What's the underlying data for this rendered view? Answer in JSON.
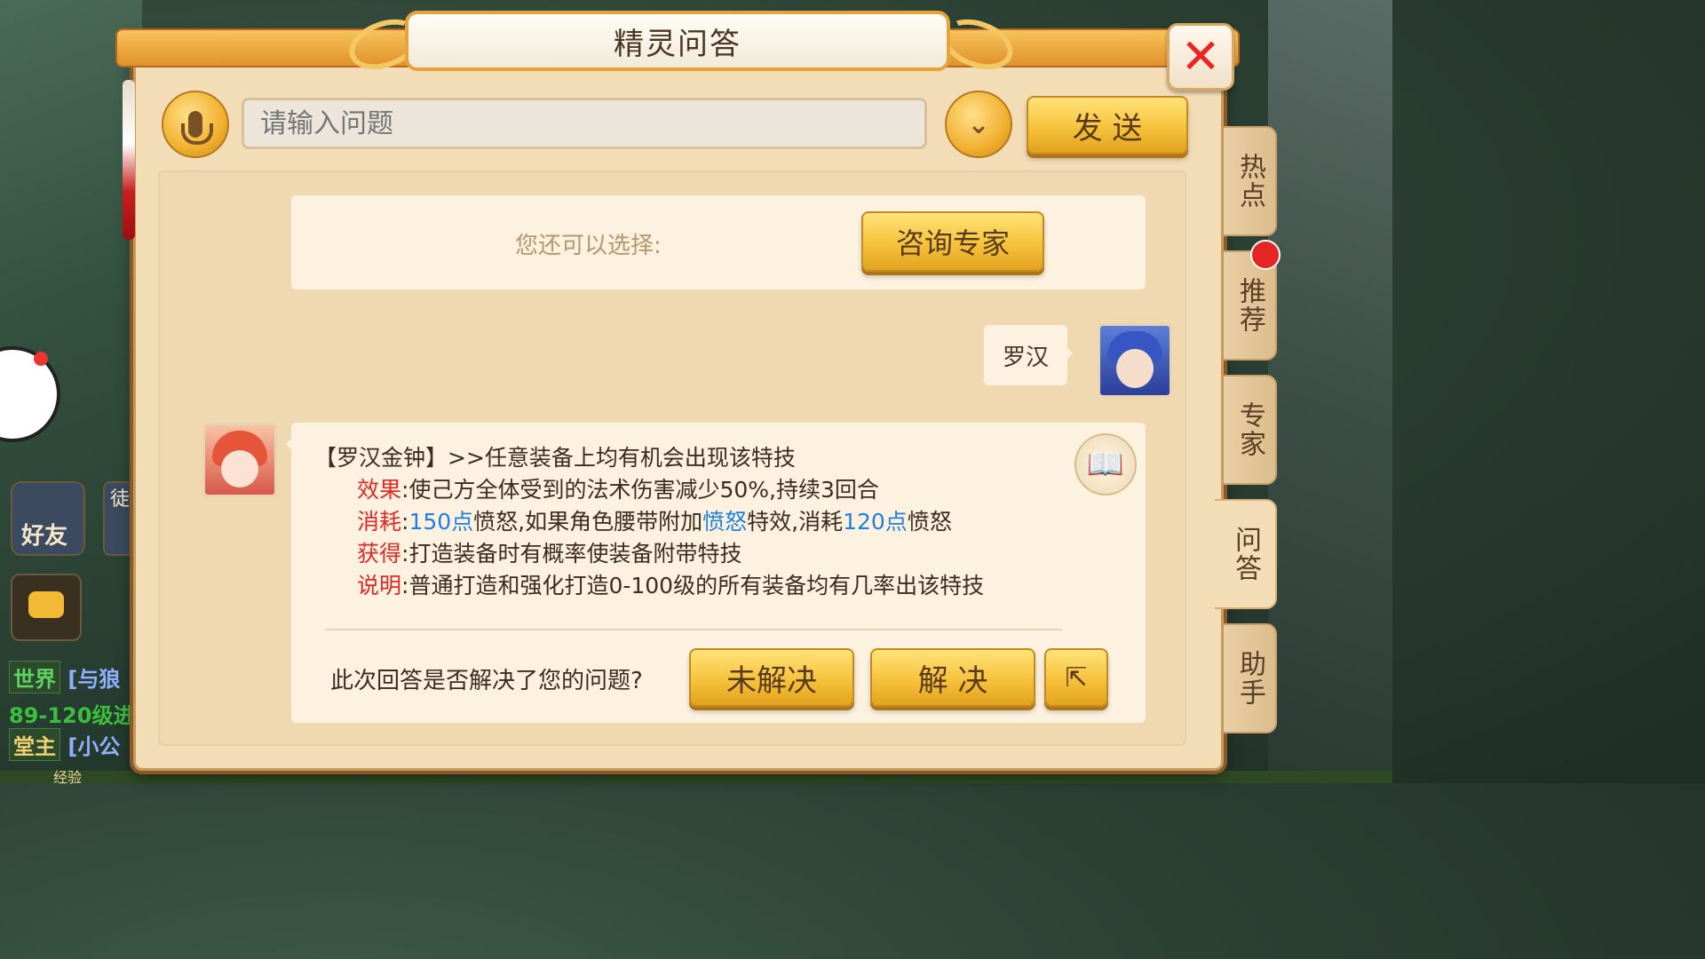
{
  "window": {
    "title": "精灵问答",
    "close_label": "✕"
  },
  "search": {
    "placeholder": "请输入问题",
    "value": "",
    "send_label": "发 送"
  },
  "options": {
    "label": "您还可以选择:",
    "expert_button": "咨询专家"
  },
  "user_message": {
    "text": "罗汉"
  },
  "answer": {
    "heading": "【罗汉金钟】>>任意装备上均有机会出现该特技",
    "effect_label": "效果",
    "effect_text": ":使己方全体受到的法术伤害减少50%,持续3回合",
    "cost_label": "消耗",
    "cost_sep": ":",
    "cost_v1": "150点",
    "cost_t1": "愤怒,如果角色腰带附加",
    "cost_link": "愤怒",
    "cost_t2": "特效,消耗",
    "cost_v2": "120点",
    "cost_t3": "愤怒",
    "obtain_label": "获得",
    "obtain_text": ":打造装备时有概率使装备附带特技",
    "note_label": "说明",
    "note_text": ":普通打造和强化打造0-100级的所有装备均有几率出该特技"
  },
  "feedback": {
    "question": "此次回答是否解决了您的问题?",
    "unresolved_label": "未解决",
    "resolved_label": "解 决",
    "share_icon": "share-icon"
  },
  "side_tabs": [
    {
      "label": "热点"
    },
    {
      "label": "推荐"
    },
    {
      "label": "专家"
    },
    {
      "label": "问答"
    },
    {
      "label": "助手"
    }
  ],
  "hud": {
    "friend_label": "好友",
    "apprentice_label": "徒",
    "chat_lines": [
      {
        "tag": "世界",
        "text": "[与狼"
      },
      {
        "tag": "",
        "text": "89-120级进"
      },
      {
        "tag": "堂主",
        "text": "[小公"
      }
    ],
    "exp_label": "经验"
  },
  "colors": {
    "accent_gold": "#f6c23b",
    "label_red": "#e02a2a",
    "link_blue": "#2080e0",
    "panel_bg": "#f3ddb7"
  }
}
